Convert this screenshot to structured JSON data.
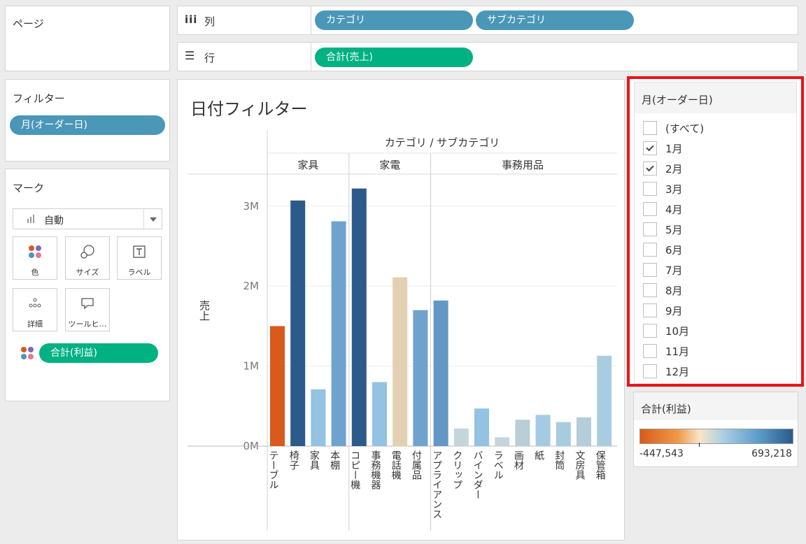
{
  "pages": {
    "title": "ページ"
  },
  "columns": {
    "label": "列",
    "icon": "columns-icon",
    "pills": [
      "カテゴリ",
      "サブカテゴリ"
    ]
  },
  "rows": {
    "label": "行",
    "icon": "rows-icon",
    "pills": [
      "合計(売上)"
    ]
  },
  "filters": {
    "title": "フィルター",
    "pills": [
      "月(オーダー日)"
    ]
  },
  "marks": {
    "title": "マーク",
    "type_select": "自動",
    "buttons": [
      "色",
      "サイズ",
      "ラベル",
      "詳細",
      "ツールヒ…"
    ],
    "color_pill": "合計(利益)"
  },
  "sheet": {
    "title": "日付フィルター"
  },
  "filter_card": {
    "title": "月(オーダー日)",
    "items": [
      {
        "label": "(すべて)",
        "checked": false
      },
      {
        "label": "1月",
        "checked": true
      },
      {
        "label": "2月",
        "checked": true
      },
      {
        "label": "3月",
        "checked": false
      },
      {
        "label": "4月",
        "checked": false
      },
      {
        "label": "5月",
        "checked": false
      },
      {
        "label": "6月",
        "checked": false
      },
      {
        "label": "7月",
        "checked": false
      },
      {
        "label": "8月",
        "checked": false
      },
      {
        "label": "9月",
        "checked": false
      },
      {
        "label": "10月",
        "checked": false
      },
      {
        "label": "11月",
        "checked": false
      },
      {
        "label": "12月",
        "checked": false
      }
    ],
    "highlight_color": "#e8141a"
  },
  "legend": {
    "title": "合計(利益)",
    "min": "-447,543",
    "max": "693,218",
    "colors": [
      "#d95a1c",
      "#f09a4a",
      "#f7e6c7",
      "#a9cde3",
      "#5b9bc9",
      "#2a5a8a"
    ]
  },
  "chart_data": {
    "type": "bar",
    "header_title": "カテゴリ / サブカテゴリ",
    "ylabel": "売上",
    "ylim": [
      0,
      3400000
    ],
    "yticks": [
      {
        "value": 0,
        "label": "0M"
      },
      {
        "value": 1000000,
        "label": "1M"
      },
      {
        "value": 2000000,
        "label": "2M"
      },
      {
        "value": 3000000,
        "label": "3M"
      }
    ],
    "groups": [
      {
        "name": "家具",
        "bars": [
          {
            "label": "テーブル",
            "value": 1500000,
            "color": "#d95a1c"
          },
          {
            "label": "椅子",
            "value": 3070000,
            "color": "#2c5a8a"
          },
          {
            "label": "家具",
            "value": 710000,
            "color": "#93c2e2"
          },
          {
            "label": "本棚",
            "value": 2810000,
            "color": "#6fa3ce"
          }
        ]
      },
      {
        "name": "家電",
        "bars": [
          {
            "label": "コピー機",
            "value": 3220000,
            "color": "#2c5a8a"
          },
          {
            "label": "事務機器",
            "value": 800000,
            "color": "#93c2e2"
          },
          {
            "label": "電話機",
            "value": 2110000,
            "color": "#e3d0b3"
          },
          {
            "label": "付属品",
            "value": 1700000,
            "color": "#6fa3ce"
          }
        ]
      },
      {
        "name": "事務用品",
        "bars": [
          {
            "label": "アプライアンス",
            "value": 1820000,
            "color": "#6397c6"
          },
          {
            "label": "クリップ",
            "value": 220000,
            "color": "#c4d6dc"
          },
          {
            "label": "バインダー",
            "value": 470000,
            "color": "#93c2e2"
          },
          {
            "label": "ラベル",
            "value": 110000,
            "color": "#c4d6dc"
          },
          {
            "label": "画材",
            "value": 330000,
            "color": "#b9ced7"
          },
          {
            "label": "紙",
            "value": 390000,
            "color": "#a4cbe3"
          },
          {
            "label": "封筒",
            "value": 300000,
            "color": "#a8ccde"
          },
          {
            "label": "文房具",
            "value": 360000,
            "color": "#b4cdd8"
          },
          {
            "label": "保管箱",
            "value": 1130000,
            "color": "#a9cde0"
          }
        ]
      }
    ]
  }
}
